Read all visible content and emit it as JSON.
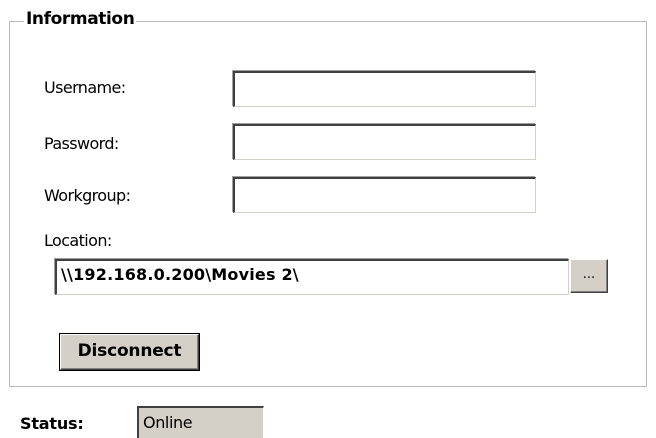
{
  "group": {
    "title": "Information"
  },
  "fields": {
    "username": {
      "label": "Username:",
      "value": ""
    },
    "password": {
      "label": "Password:",
      "value": ""
    },
    "workgroup": {
      "label": "Workgroup:",
      "value": ""
    },
    "location": {
      "label": "Location:",
      "value": "\\\\192.168.0.200\\Movies 2\\"
    }
  },
  "buttons": {
    "browse_label": "...",
    "disconnect_label": "Disconnect"
  },
  "status": {
    "label": "Status:",
    "value": "Online"
  },
  "colors": {
    "background": "#ffffff",
    "button_face": "#d4d0c8",
    "groupbox_border": "#b8b8b8"
  }
}
